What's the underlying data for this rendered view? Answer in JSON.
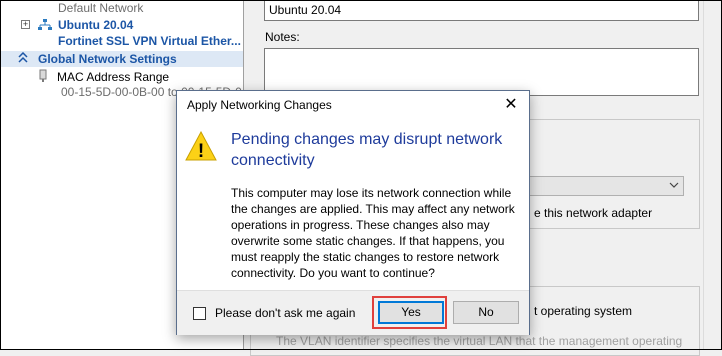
{
  "left_pane": {
    "default_network": "Default Network",
    "ubuntu_label": "Ubuntu 20.04",
    "fortinet_label": "Fortinet SSL VPN Virtual Ether...",
    "global_settings_label": "Global Network Settings",
    "mac_range_label": "MAC Address Range",
    "mac_range_value": "00-15-5D-00-0B-00 to 00-15-5D-0..."
  },
  "right_pane": {
    "name_value": "Ubuntu 20.04",
    "notes_label": "Notes:",
    "adapter_text": "e this network adapter",
    "os_text": "t operating system",
    "vlan_text": "The VLAN identifier specifies the virtual LAN that the management operating"
  },
  "dialog": {
    "title": "Apply Networking Changes",
    "close_glyph": "✕",
    "warning_glyph": "!",
    "heading": "Pending changes may disrupt network connectivity",
    "body": "This computer may lose its network connection while the changes are applied. This may affect any network operations in progress. These changes also may overwrite some static changes. If that happens, you must reapply the static changes to restore network connectivity. Do you want to continue?",
    "checkbox_label": "Please don't ask me again",
    "yes_label": "Yes",
    "no_label": "No"
  },
  "colors": {
    "accent": "#1c56a6",
    "heading": "#1e3b9b",
    "highlight": "#e0403c",
    "warning": "#fcd116"
  }
}
